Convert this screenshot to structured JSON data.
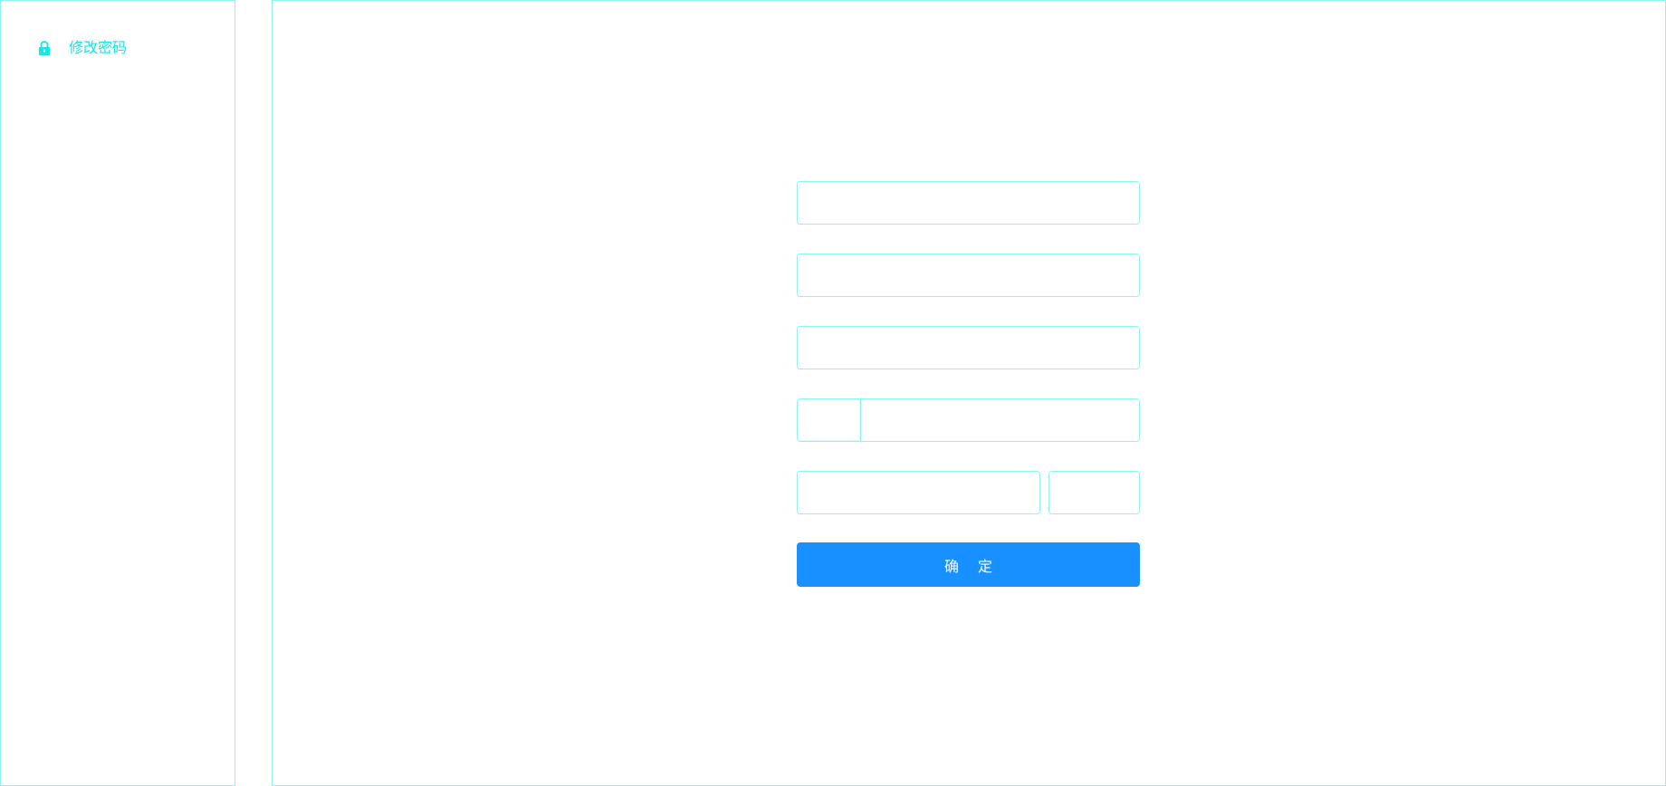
{
  "sidebar": {
    "items": [
      {
        "label": "修改密码",
        "icon": "lock-icon",
        "active": true
      }
    ]
  },
  "form": {
    "fields": [
      {
        "value": "",
        "placeholder": ""
      },
      {
        "value": "",
        "placeholder": ""
      },
      {
        "value": "",
        "placeholder": ""
      }
    ],
    "phone": {
      "prefix": "",
      "value": "",
      "placeholder": ""
    },
    "code": {
      "value": "",
      "placeholder": "",
      "button_label": ""
    },
    "submit_label": "确 定"
  },
  "colors": {
    "accent": "#16e6e6",
    "border": "#8ef3f3",
    "primary": "#1890ff",
    "background": "#ffffff"
  }
}
